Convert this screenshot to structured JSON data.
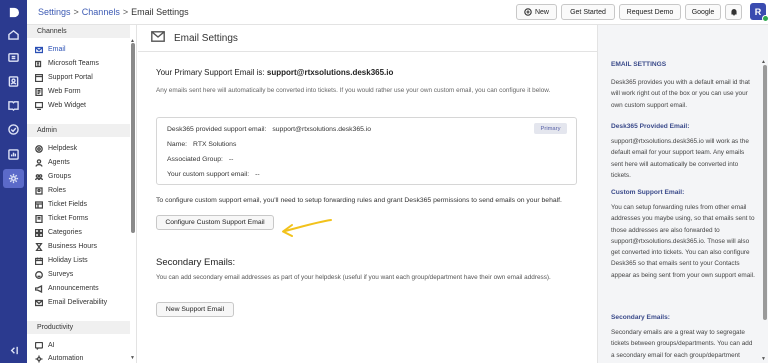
{
  "topbar": {
    "breadcrumb": {
      "root": "Settings",
      "sep1": ">",
      "mid": "Channels",
      "sep2": ">",
      "current": "Email Settings"
    },
    "new_label": "New",
    "get_started_label": "Get Started",
    "request_demo_label": "Request Demo",
    "google_label": "Google",
    "avatar_letter": "R"
  },
  "sidebar": {
    "sections": [
      {
        "title": "Channels",
        "items": [
          "Email",
          "Microsoft Teams",
          "Support Portal",
          "Web Form",
          "Web Widget"
        ]
      },
      {
        "title": "Admin",
        "items": [
          "Helpdesk",
          "Agents",
          "Groups",
          "Roles",
          "Ticket Fields",
          "Ticket Forms",
          "Categories",
          "Business Hours",
          "Holiday Lists",
          "Surveys",
          "Announcements",
          "Email Deliverability"
        ]
      },
      {
        "title": "Productivity",
        "items": [
          "AI",
          "Automation"
        ]
      }
    ]
  },
  "main": {
    "title": "Email Settings",
    "primary_label": "Your Primary Support Email is:",
    "primary_email": "support@rtxsolutions.desk365.io",
    "note_text": "Any emails sent here will automatically be converted into tickets. If you would rather use your own custom email, you can configure it below.",
    "info": {
      "provided_label": "Desk365 provided support email:",
      "provided_value": "support@rtxsolutions.desk365.io",
      "badge": "Primary",
      "name_label": "Name:",
      "name_value": "RTX Solutions",
      "group_label": "Associated Group:",
      "group_value": "--",
      "custom_label": "Your custom support email:",
      "custom_value": "--"
    },
    "forward_text": "To configure custom support email, you'll need to setup forwarding rules and grant Desk365 permissions to send emails on your behalf.",
    "configure_button": "Configure Custom Support Email",
    "secondary_title": "Secondary Emails:",
    "secondary_text": "You can add secondary email addresses as part of your helpdesk (useful if you want each group/department have their own email address).",
    "new_support_button": "New Support Email",
    "arrow_color": "#f2c21b"
  },
  "help": {
    "title": "EMAIL SETTINGS",
    "intro": "Desk365 provides you with a default email id that will work right out of the box or you can use your own custom support email.",
    "provided_title": "Desk365 Provided Email:",
    "provided_text": "support@rtxsolutions.desk365.io will work as the default email for your support team. Any emails sent here will automatically be converted into tickets.",
    "custom_title": "Custom Support Email:",
    "custom_text": "You can setup forwarding rules from other email addresses you maybe using, so that emails sent to those addresses are also forwarded to support@rtxsolutions.desk365.io. Those will also get converted into tickets. You can also configure Desk365 so that emails sent to your Contacts appear as being sent from your own support email.",
    "secondary_title": "Secondary Emails:",
    "secondary_text": "Secondary emails are a great way to segregate tickets between groups/departments. You can add a secondary email for each group/department"
  }
}
